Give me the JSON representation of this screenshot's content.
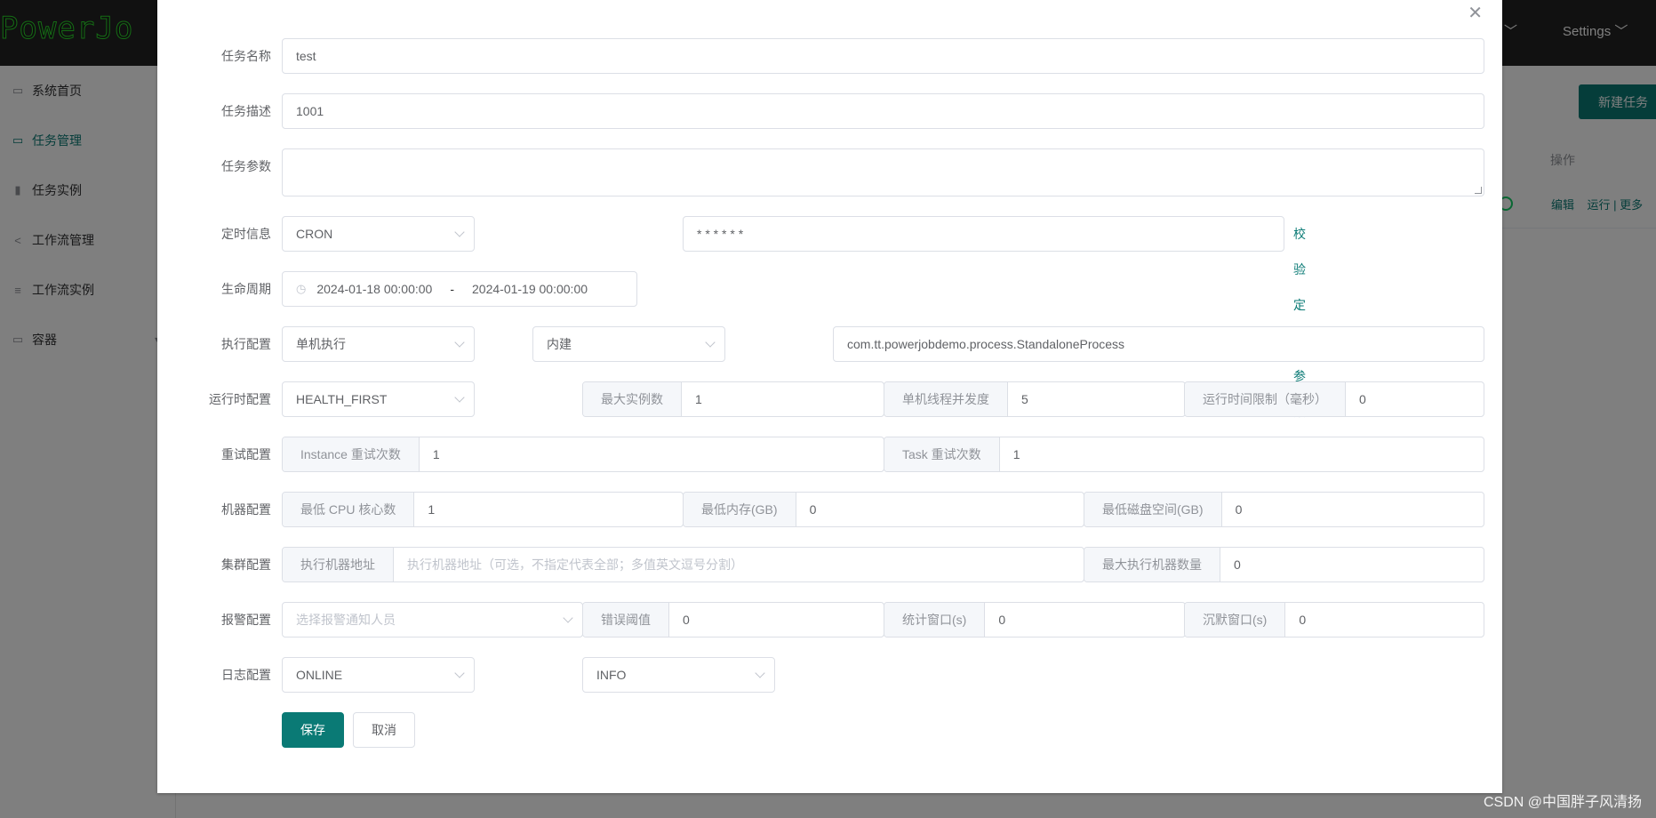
{
  "app": {
    "logo_text": "PowerJo",
    "top_menu": {
      "dropdown_arrow": "﹀",
      "settings": "Settings"
    },
    "sidebar": [
      {
        "label": "系统首页",
        "icon": "monitor-icon"
      },
      {
        "label": "任务管理",
        "icon": "task-icon",
        "active": true
      },
      {
        "label": "任务实例",
        "icon": "bar-chart-icon"
      },
      {
        "label": "工作流管理",
        "icon": "share-icon"
      },
      {
        "label": "工作流实例",
        "icon": "sliders-icon"
      },
      {
        "label": "容器",
        "icon": "container-icon",
        "has_children": true
      }
    ],
    "new_task_button": "新建任务",
    "table_header_ops": "操作",
    "row_ops": {
      "edit": "编辑",
      "run": "运行",
      "more": "更多"
    }
  },
  "form": {
    "task_name": {
      "label": "任务名称",
      "value": "test"
    },
    "task_desc": {
      "label": "任务描述",
      "value": "1001"
    },
    "task_params": {
      "label": "任务参数",
      "value": ""
    },
    "schedule": {
      "label": "定时信息",
      "type": "CRON",
      "expression": "* * * * * *",
      "validate_link": "校验定时参数"
    },
    "lifecycle": {
      "label": "生命周期",
      "start": "2024-01-18 00:00:00",
      "separator": "-",
      "end": "2024-01-19 00:00:00"
    },
    "execution": {
      "label": "执行配置",
      "mode": "单机执行",
      "processor_type": "内建",
      "processor_info": "com.tt.powerjobdemo.process.StandaloneProcess"
    },
    "runtime": {
      "label": "运行时配置",
      "dispatch_strategy": "HEALTH_FIRST",
      "max_instances_label": "最大实例数",
      "max_instances": "1",
      "concurrency_label": "单机线程并发度",
      "concurrency": "5",
      "time_limit_label": "运行时间限制（毫秒）",
      "time_limit": "0"
    },
    "retry": {
      "label": "重试配置",
      "instance_label": "Instance 重试次数",
      "instance_retry": "1",
      "task_label": "Task 重试次数",
      "task_retry": "1"
    },
    "machine": {
      "label": "机器配置",
      "cpu_label": "最低 CPU 核心数",
      "cpu": "1",
      "memory_label": "最低内存(GB)",
      "memory": "0",
      "disk_label": "最低磁盘空间(GB)",
      "disk": "0"
    },
    "cluster": {
      "label": "集群配置",
      "address_label": "执行机器地址",
      "address_placeholder": "执行机器地址（可选，不指定代表全部；多值英文逗号分割）",
      "max_workers_label": "最大执行机器数量",
      "max_workers": "0"
    },
    "alarm": {
      "label": "报警配置",
      "receivers_placeholder": "选择报警通知人员",
      "threshold_label": "错误阈值",
      "threshold": "0",
      "window_label": "统计窗口(s)",
      "window": "0",
      "silence_label": "沉默窗口(s)",
      "silence": "0"
    },
    "log": {
      "label": "日志配置",
      "type": "ONLINE",
      "level": "INFO"
    },
    "save_button": "保存",
    "cancel_button": "取消"
  },
  "watermark": "CSDN @中国胖子风清扬",
  "colors": {
    "primary": "#0a7a75",
    "topbar": "#222222"
  }
}
